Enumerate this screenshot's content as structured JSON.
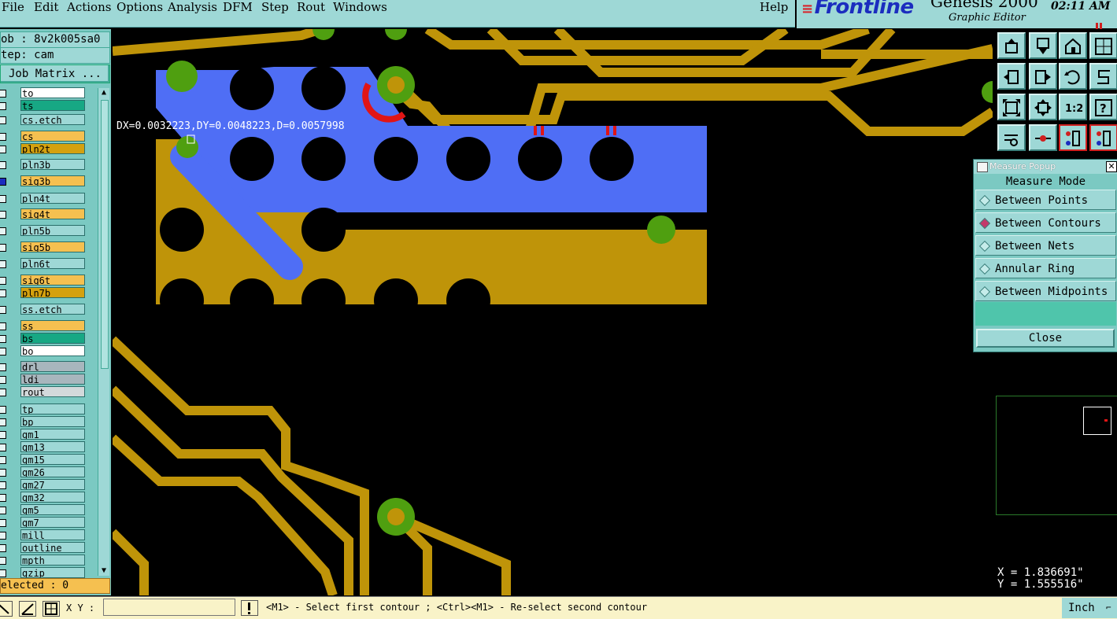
{
  "menubar": {
    "items": [
      "File",
      "Edit",
      "Actions",
      "Options",
      "Analysis",
      "DFM",
      "Step",
      "Rout",
      "Windows"
    ],
    "help": "Help"
  },
  "brand": {
    "logo": "Frontline",
    "product": "Genesis 2000",
    "subtitle": "Graphic Editor",
    "time": "02:11 AM"
  },
  "left_panel": {
    "job": "ob : 8v2k005sa0",
    "step": "tep: cam",
    "job_matrix": "Job Matrix ...",
    "layers": [
      {
        "name": "to",
        "color": "#ffffff",
        "checked": false
      },
      {
        "name": "ts",
        "color": "#17a884",
        "checked": false
      },
      {
        "name": "cs.etch",
        "color": "#9ed8d6",
        "checked": false
      },
      {
        "name": "cs",
        "color": "#f5c050",
        "checked": false
      },
      {
        "name": "pln2t",
        "color": "#d4a10f",
        "checked": false
      },
      {
        "name": "pln3b",
        "color": "#9ed8d6",
        "checked": false
      },
      {
        "name": "sig3b",
        "color": "#f5c050",
        "checked": true
      },
      {
        "name": "pln4t",
        "color": "#9ed8d6",
        "checked": false
      },
      {
        "name": "sig4t",
        "color": "#f5c050",
        "checked": false
      },
      {
        "name": "pln5b",
        "color": "#9ed8d6",
        "checked": false
      },
      {
        "name": "sig5b",
        "color": "#f5c050",
        "checked": false
      },
      {
        "name": "pln6t",
        "color": "#9ed8d6",
        "checked": false
      },
      {
        "name": "sig6t",
        "color": "#f5c050",
        "checked": false
      },
      {
        "name": "pln7b",
        "color": "#d4a10f",
        "checked": false
      },
      {
        "name": "ss.etch",
        "color": "#9ed8d6",
        "checked": false
      },
      {
        "name": "ss",
        "color": "#f5c050",
        "checked": false
      },
      {
        "name": "bs",
        "color": "#17a884",
        "checked": false
      },
      {
        "name": "bo",
        "color": "#ffffff",
        "checked": false
      },
      {
        "name": "drl",
        "color": "#a8b6bd",
        "checked": false
      },
      {
        "name": "ldi",
        "color": "#a8b6bd",
        "checked": false
      },
      {
        "name": "rout",
        "color": "#d3d9db",
        "checked": false
      },
      {
        "name": "tp",
        "color": "#9ed8d6",
        "checked": false
      },
      {
        "name": "bp",
        "color": "#9ed8d6",
        "checked": false
      },
      {
        "name": "gm1",
        "color": "#9ed8d6",
        "checked": false
      },
      {
        "name": "gm13",
        "color": "#9ed8d6",
        "checked": false
      },
      {
        "name": "gm15",
        "color": "#9ed8d6",
        "checked": false
      },
      {
        "name": "gm26",
        "color": "#9ed8d6",
        "checked": false
      },
      {
        "name": "gm27",
        "color": "#9ed8d6",
        "checked": false
      },
      {
        "name": "gm32",
        "color": "#9ed8d6",
        "checked": false
      },
      {
        "name": "gm5",
        "color": "#9ed8d6",
        "checked": false
      },
      {
        "name": "gm7",
        "color": "#9ed8d6",
        "checked": false
      },
      {
        "name": "mill",
        "color": "#9ed8d6",
        "checked": false
      },
      {
        "name": "outline",
        "color": "#9ed8d6",
        "checked": false
      },
      {
        "name": "mpth",
        "color": "#9ed8d6",
        "checked": false
      },
      {
        "name": "gzip",
        "color": "#9ed8d6",
        "checked": false
      }
    ],
    "selected": "elected : 0"
  },
  "canvas": {
    "measure_readout": "DX=0.0032223,DY=0.0048223,D=0.0057998",
    "colors": {
      "copper": "#bf9409",
      "selected": "#4f6ef5",
      "pad": "#4f9f10",
      "hilite": "#e11515"
    }
  },
  "measure_popup": {
    "title": "Measure Popup",
    "heading": "Measure Mode",
    "options": [
      {
        "label": "Between Points",
        "selected": false
      },
      {
        "label": "Between Contours",
        "selected": true
      },
      {
        "label": "Between Nets",
        "selected": false
      },
      {
        "label": "Annular Ring",
        "selected": false
      },
      {
        "label": "Between Midpoints",
        "selected": false
      }
    ],
    "close": "Close"
  },
  "coords": {
    "x": "X = 1.836691\"",
    "y": "Y = 1.555516\""
  },
  "bottom": {
    "xy_label": "X Y :",
    "xy_value": "",
    "prompt": "<M1> - Select first contour ; <Ctrl><M1> - Re-select second contour",
    "unit": "Inch"
  }
}
